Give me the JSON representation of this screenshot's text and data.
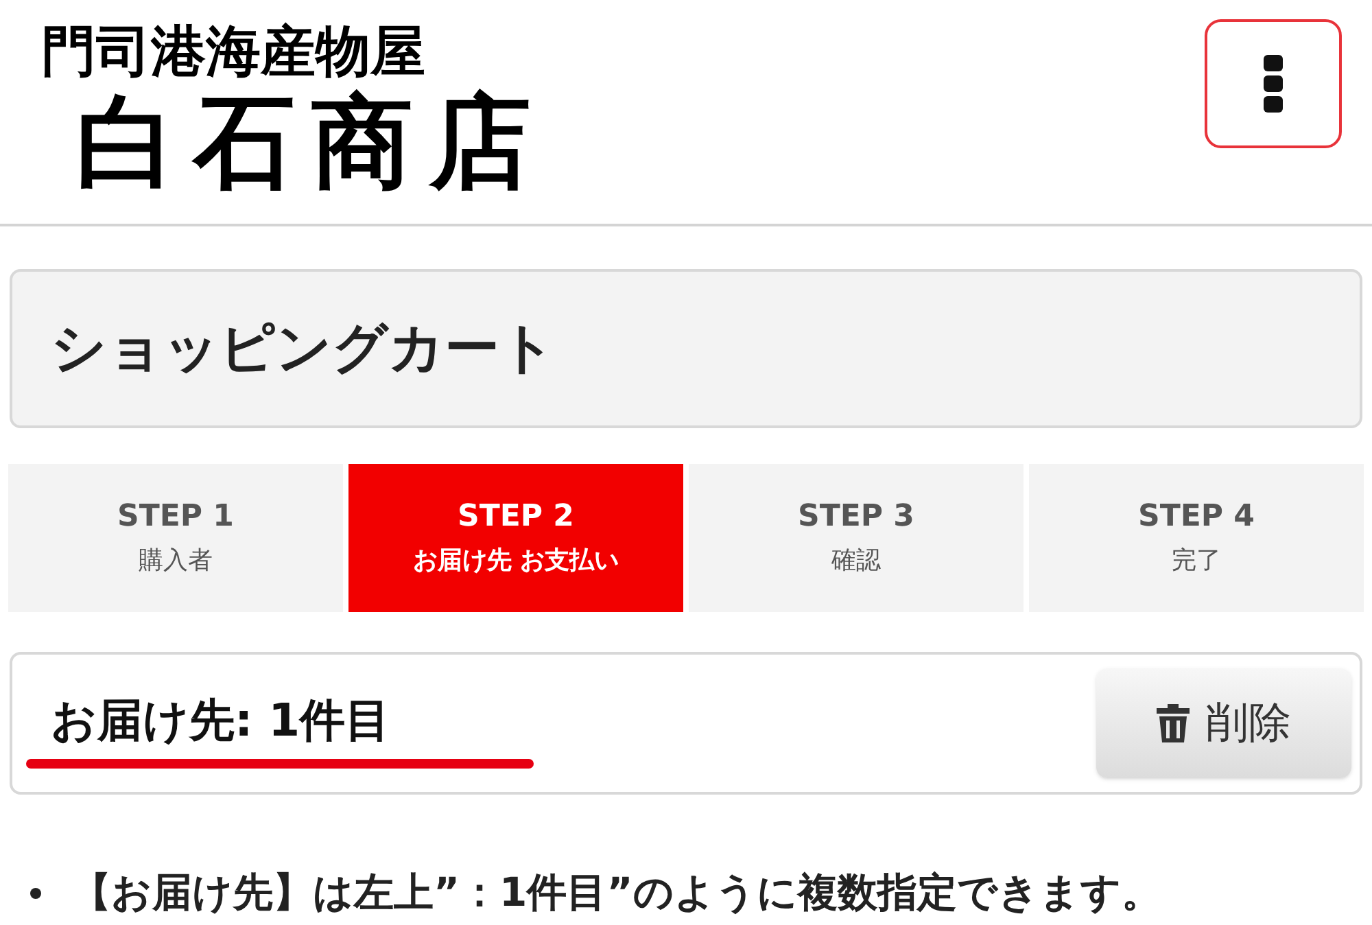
{
  "header": {
    "logo_subtitle": "門司港海産物屋",
    "logo_title": "白石商店"
  },
  "page_title": "ショッピングカート",
  "steps": [
    {
      "label": "STEP 1",
      "caption": "購入者",
      "selected": false
    },
    {
      "label": "STEP 2",
      "caption": "お届け先 お支払い",
      "selected": true
    },
    {
      "label": "STEP 3",
      "caption": "確認",
      "selected": false
    },
    {
      "label": "STEP 4",
      "caption": "完了",
      "selected": false
    }
  ],
  "delivery": {
    "heading": "お届け先: 1件目",
    "delete_button": "削除"
  },
  "notes": [
    "【お届け先】は左上”：1件目”のように複数指定できます。"
  ]
}
